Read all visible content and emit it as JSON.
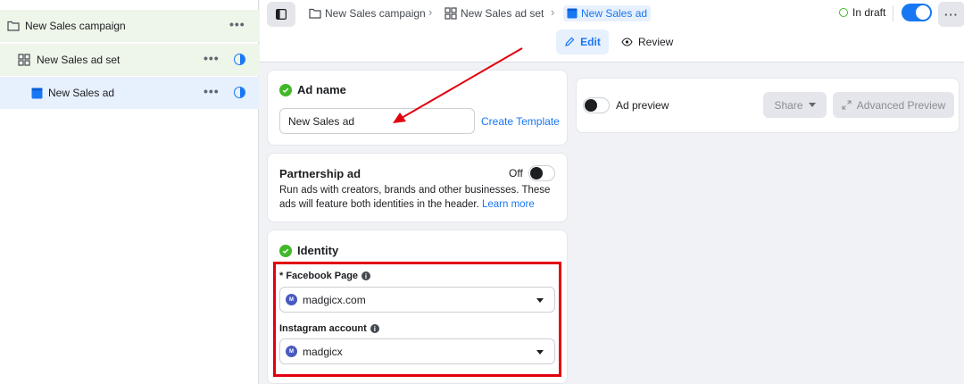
{
  "sidebar": {
    "campaign": {
      "label": "New Sales campaign",
      "icon": "folder-icon"
    },
    "adset": {
      "label": "New Sales ad set",
      "icon": "grid-icon"
    },
    "ad": {
      "label": "New Sales ad",
      "icon": "ad-icon"
    },
    "more_label": "•••"
  },
  "topbar": {
    "breadcrumb": [
      {
        "label": "New Sales campaign",
        "icon": "folder-icon"
      },
      {
        "label": "New Sales ad set",
        "icon": "grid-icon"
      },
      {
        "label": "New Sales ad",
        "icon": "ad-icon"
      }
    ],
    "separator": "›",
    "status": "In draft",
    "more_label": "···",
    "tabs": {
      "edit": "Edit",
      "review": "Review"
    }
  },
  "ad_name": {
    "title": "Ad name",
    "value": "New Sales ad",
    "create_template": "Create Template"
  },
  "partnership": {
    "title": "Partnership ad",
    "toggle_label": "Off",
    "description": "Run ads with creators, brands and other businesses. These ads will feature both identities in the header.",
    "learn_more": "Learn more"
  },
  "identity": {
    "title": "Identity",
    "facebook_page_label": "* Facebook Page",
    "facebook_page_value": "madgicx.com",
    "instagram_label": "Instagram account",
    "instagram_value": "madgicx",
    "avatar_text": "M"
  },
  "preview": {
    "label": "Ad preview",
    "share": "Share",
    "advanced": "Advanced Preview"
  },
  "colors": {
    "accent": "#1877f2",
    "success": "#42b72a",
    "annotation": "#e3000f"
  }
}
